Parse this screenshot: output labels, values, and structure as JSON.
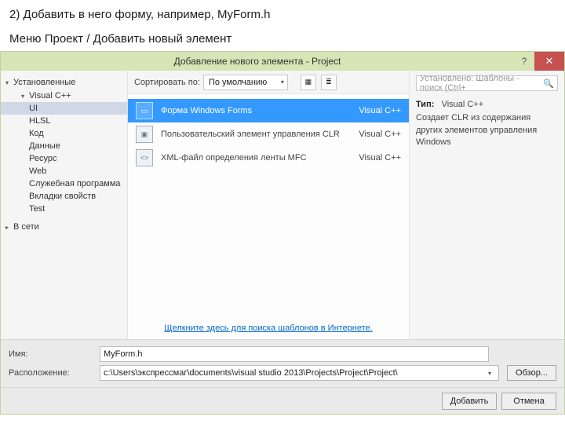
{
  "instructions": {
    "line1": "2) Добавить в него форму, например, MyForm.h",
    "line2": "Меню Проект / Добавить новый элемент"
  },
  "titlebar": {
    "title": "Добавление нового элемента - Project",
    "help": "?",
    "close": "✕"
  },
  "left": {
    "installed": "Установленные",
    "vcpp": "Visual C++",
    "items": [
      "UI",
      "HLSL",
      "Код",
      "Данные",
      "Ресурс",
      "Web",
      "Служебная программа",
      "Вкладки свойств",
      "Test"
    ],
    "online": "В сети"
  },
  "toolbar": {
    "sort_label": "Сортировать по:",
    "sort_value": "По умолчанию"
  },
  "templates": [
    {
      "label": "Форма Windows Forms",
      "lang": "Visual C++",
      "icon_name": "winforms-icon",
      "glyph": "▭"
    },
    {
      "label": "Пользовательский элемент управления CLR",
      "lang": "Visual C++",
      "icon_name": "usercontrol-icon",
      "glyph": "▣"
    },
    {
      "label": "XML-файл определения ленты MFC",
      "lang": "Visual C++",
      "icon_name": "ribbon-xml-icon",
      "glyph": "<>"
    }
  ],
  "selected_template_index": 0,
  "selected_tree_index": 0,
  "center_footer_link": "Щелкните здесь для поиска шаблонов в Интернете.",
  "right": {
    "search_placeholder": "Установлено: Шаблоны - поиск (Ctrl+",
    "type_prefix": "Тип:",
    "type_value": "Visual C++",
    "description": "Создает CLR из содержания других элементов управления Windows"
  },
  "form": {
    "name_label": "Имя:",
    "name_value": "MyForm.h",
    "location_label": "Расположение:",
    "location_value": "c:\\Users\\экспрессмаг\\documents\\visual studio 2013\\Projects\\Project\\Project\\",
    "browse": "Обзор..."
  },
  "buttons": {
    "add": "Добавить",
    "cancel": "Отмена"
  }
}
